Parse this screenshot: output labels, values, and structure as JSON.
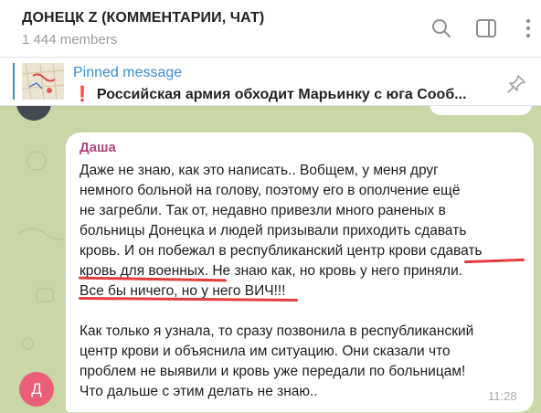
{
  "header": {
    "title": "ДОНЕЦК Z (КОММЕНТАРИИ, ЧАТ)",
    "members": "1 444 members",
    "icons": [
      "search-icon",
      "sidebar-toggle-icon",
      "more-vert-icon"
    ]
  },
  "pinned": {
    "label": "Pinned message",
    "exclamation": "❗",
    "text": "Российская армия обходит Марьинку с юга  Сооб...",
    "icon": "unpin-icon"
  },
  "message": {
    "sender": "Даша",
    "lines": [
      "Даже не знаю, как это написать.. Вобщем, у меня друг",
      "немного больной на голову, поэтому его в ополчение ещё",
      "не загребли. Так от, недавно привезли много раненых в",
      "больницы Донецка и людей призывали приходить сдавать",
      "кровь. И он побежал в республиканский центр крови сдавать",
      "кровь для военных. Не знаю как, но кровь у него приняли.",
      "Все бы ничего, но у него ВИЧ!!!",
      "",
      "Как только я узнала, то сразу позвонила в республиканский",
      "центр крови и объяснила им ситуацию. Они сказали что",
      "проблем не выявили и кровь уже передали по больницам!",
      "Что дальше с этим делать не знаю.."
    ],
    "time": "11:28",
    "avatar_letter": "Д"
  },
  "colors": {
    "accent": "#3a8fd8",
    "sender": "#b2457f",
    "avatar": "#ea5f78",
    "underline": "#e23c3c",
    "chat_bg": "#c9d6a6"
  }
}
